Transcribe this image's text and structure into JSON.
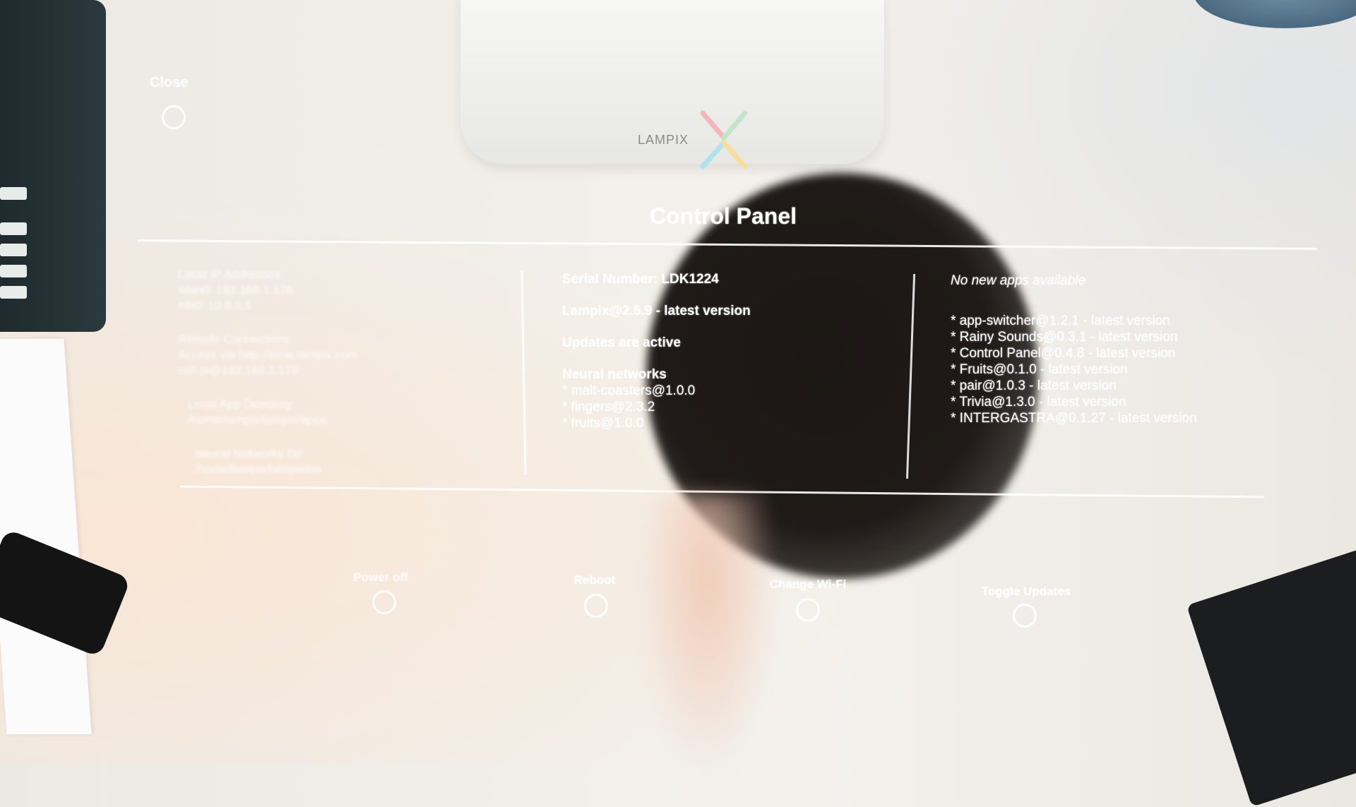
{
  "ui": {
    "close_label": "Close",
    "title": "Control Panel",
    "left_column": [
      "Local IP Addresses:",
      "wlan0: 192.168.1.176",
      "eth0: 10.0.0.5",
      "Remote Connections:",
      "Access via http://local.lampix.com",
      "ssh pi@192.168.1.176",
      "Local App Directory:",
      "/home/lampix/lampix/apps",
      "Neural Networks Dir:",
      "/home/lampix/lampix/nn"
    ],
    "middle_column": {
      "serial": "Serial Number: LDK1224",
      "version": "Lampix@2.5.9 - latest version",
      "updates": "Updates are active",
      "nn_title": "Neural networks",
      "nn_items": [
        "* malt-coasters@1.0.0",
        "* fingers@2.3.2",
        "* fruits@1.0.0"
      ]
    },
    "right_column": {
      "header": "No new apps available",
      "apps": [
        "* app-switcher@1.2.1 - latest version",
        "* Rainy Sounds@0.3.1 - latest version",
        "* Control Panel@0.4.8 - latest version",
        "* Fruits@0.1.0 - latest version",
        "* pair@1.0.3 - latest version",
        "* Trivia@1.3.0 - latest version",
        "* INTERGASTRA@0.1.27 - latest version"
      ]
    },
    "actions": {
      "power_off": "Power off",
      "reboot": "Reboot",
      "change_wifi": "Change Wi-Fi",
      "toggle_updates": "Toggle Updates"
    }
  },
  "device": {
    "brand": "LAMPIX"
  }
}
